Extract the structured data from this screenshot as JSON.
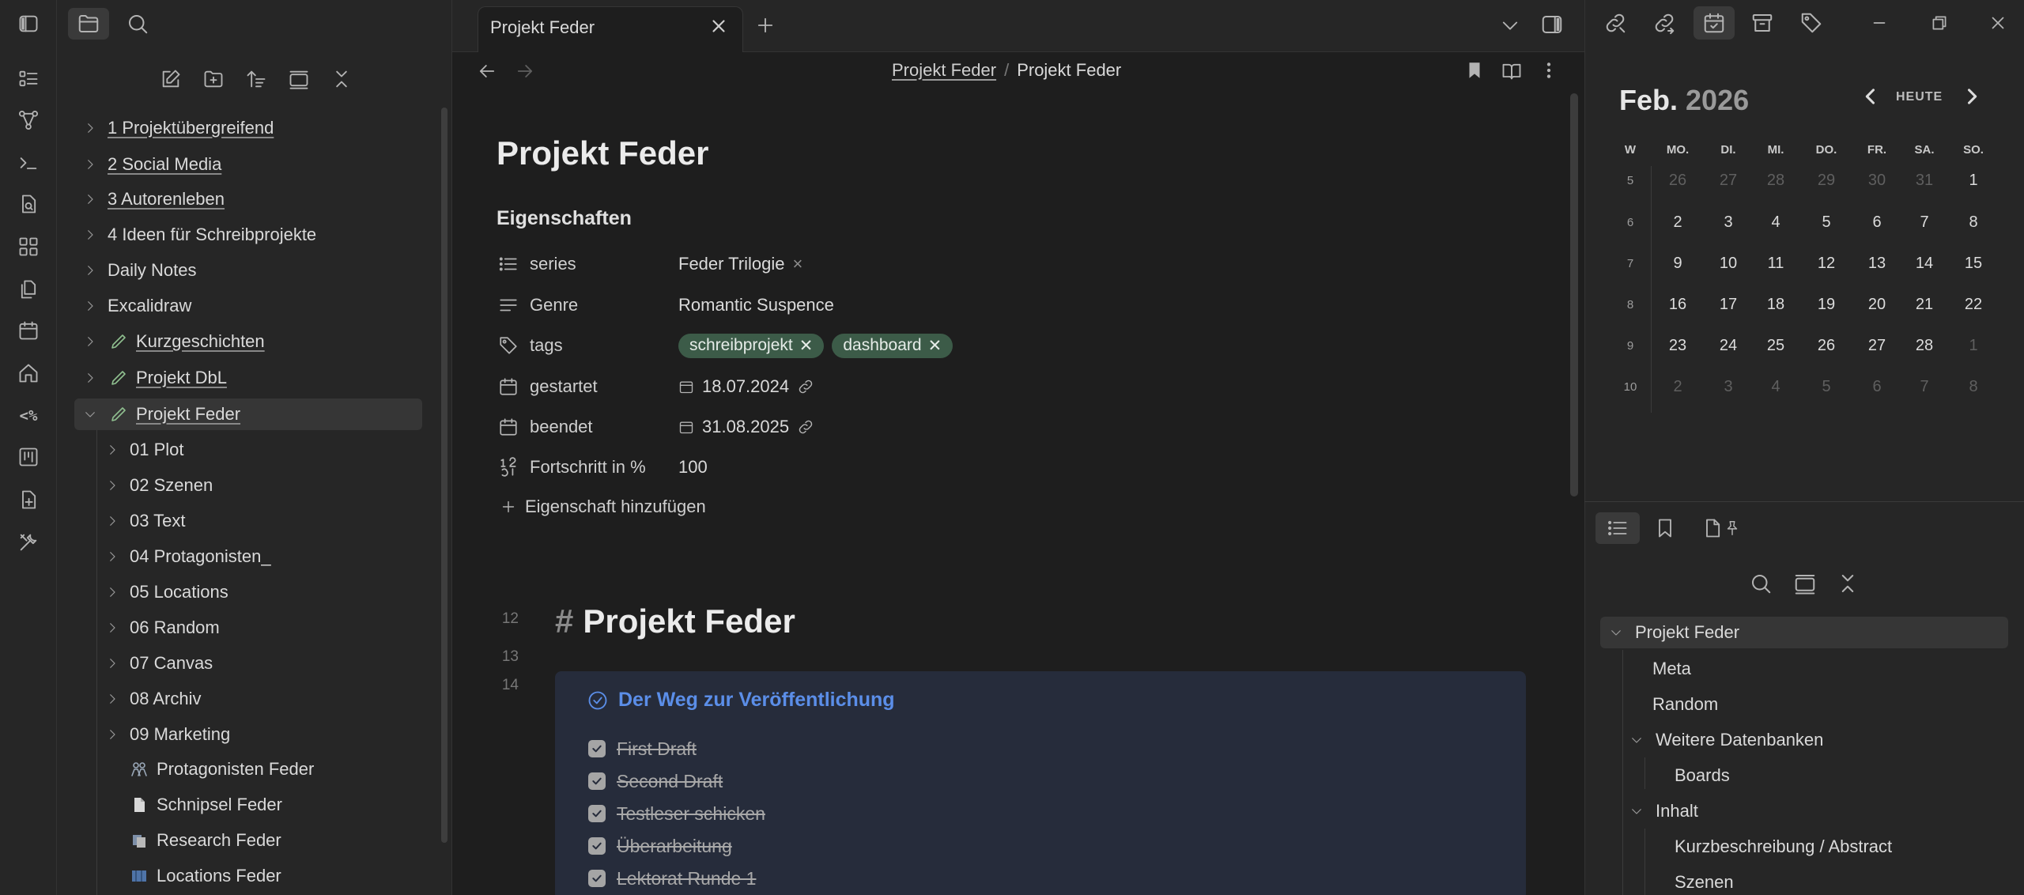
{
  "tab": {
    "title": "Projekt Feder"
  },
  "breadcrumb": {
    "parent": "Projekt Feder",
    "separator": "/",
    "current": "Projekt Feder"
  },
  "file_tree": {
    "items": [
      {
        "label": "1 Projektübergreifend",
        "underlined": true
      },
      {
        "label": "2 Social Media",
        "underlined": true
      },
      {
        "label": "3 Autorenleben",
        "underlined": true
      },
      {
        "label": "4 Ideen für Schreibprojekte",
        "underlined": false
      },
      {
        "label": "Daily Notes",
        "underlined": false
      },
      {
        "label": "Excalidraw",
        "underlined": false
      },
      {
        "label": "Kurzgeschichten",
        "underlined": true
      },
      {
        "label": "Projekt DbL",
        "underlined": true
      },
      {
        "label": "Projekt Feder",
        "underlined": true,
        "selected": true
      }
    ],
    "children": [
      {
        "label": "01 Plot"
      },
      {
        "label": "02 Szenen"
      },
      {
        "label": "03 Text"
      },
      {
        "label": "04 Protagonisten_"
      },
      {
        "label": "05 Locations"
      },
      {
        "label": "06 Random"
      },
      {
        "label": "07 Canvas"
      },
      {
        "label": "08 Archiv"
      },
      {
        "label": "09 Marketing"
      }
    ],
    "files": [
      {
        "label": "Protagonisten Feder",
        "icon": "people-icon"
      },
      {
        "label": "Schnipsel Feder",
        "icon": "page-icon"
      },
      {
        "label": "Research Feder",
        "icon": "books-icon"
      },
      {
        "label": "Locations Feder",
        "icon": "map-icon"
      }
    ]
  },
  "note": {
    "title": "Projekt Feder",
    "properties_title": "Eigenschaften",
    "properties": [
      {
        "key": "series",
        "value": "Feder Trilogie",
        "icon": "list-icon"
      },
      {
        "key": "Genre",
        "value": "Romantic Suspence",
        "icon": "text-icon"
      },
      {
        "key": "tags",
        "tags": [
          "schreibprojekt",
          "dashboard"
        ],
        "icon": "tag-icon"
      },
      {
        "key": "gestartet",
        "value": "18.07.2024",
        "icon": "calendar-icon"
      },
      {
        "key": "beendet",
        "value": "31.08.2025",
        "icon": "calendar-icon"
      },
      {
        "key": "Fortschritt in %",
        "value": "100",
        "icon": "number-icon"
      }
    ],
    "add_property": "Eigenschaft hinzufügen",
    "line_numbers": [
      "12",
      "13",
      "14"
    ],
    "heading_hash": "#",
    "heading": "Projekt Feder",
    "callout_title": "Der Weg zur Veröffentlichung",
    "tasks": [
      {
        "label": "First Draft",
        "done": true
      },
      {
        "label": "Second Draft",
        "done": true
      },
      {
        "label": "Testleser schicken",
        "done": true
      },
      {
        "label": "Überarbeitung",
        "done": true
      },
      {
        "label": "Lektorat Runde 1",
        "done": true
      }
    ]
  },
  "calendar": {
    "month": "Feb.",
    "year": "2026",
    "today_label": "HEUTE",
    "week_header": "W",
    "weekdays": [
      "MO.",
      "DI.",
      "MI.",
      "DO.",
      "FR.",
      "SA.",
      "SO."
    ],
    "weeks": [
      {
        "w": "5",
        "days": [
          "26",
          "27",
          "28",
          "29",
          "30",
          "31",
          "1"
        ],
        "dim": [
          true,
          true,
          true,
          true,
          true,
          true,
          false
        ]
      },
      {
        "w": "6",
        "days": [
          "2",
          "3",
          "4",
          "5",
          "6",
          "7",
          "8"
        ],
        "dim": [
          false,
          false,
          false,
          false,
          false,
          false,
          false
        ]
      },
      {
        "w": "7",
        "days": [
          "9",
          "10",
          "11",
          "12",
          "13",
          "14",
          "15"
        ],
        "dim": [
          false,
          false,
          false,
          false,
          false,
          false,
          false
        ]
      },
      {
        "w": "8",
        "days": [
          "16",
          "17",
          "18",
          "19",
          "20",
          "21",
          "22"
        ],
        "dim": [
          false,
          false,
          false,
          false,
          false,
          false,
          false
        ]
      },
      {
        "w": "9",
        "days": [
          "23",
          "24",
          "25",
          "26",
          "27",
          "28",
          "1"
        ],
        "dim": [
          false,
          false,
          false,
          false,
          false,
          false,
          true
        ]
      },
      {
        "w": "10",
        "days": [
          "2",
          "3",
          "4",
          "5",
          "6",
          "7",
          "8"
        ],
        "dim": [
          true,
          true,
          true,
          true,
          true,
          true,
          true
        ]
      }
    ]
  },
  "outline": {
    "items": [
      {
        "label": "Projekt Feder",
        "level": 0,
        "collapsible": true,
        "selected": true
      },
      {
        "label": "Meta",
        "level": 1,
        "collapsible": false
      },
      {
        "label": "Random",
        "level": 1,
        "collapsible": false
      },
      {
        "label": "Weitere Datenbanken",
        "level": 1,
        "collapsible": true
      },
      {
        "label": "Boards",
        "level": 2,
        "collapsible": false
      },
      {
        "label": "Inhalt",
        "level": 1,
        "collapsible": true
      },
      {
        "label": "Kurzbeschreibung / Abstract",
        "level": 2,
        "collapsible": false
      },
      {
        "label": "Szenen",
        "level": 2,
        "collapsible": false
      }
    ]
  },
  "colors": {
    "accent_blue": "#5b8ee8",
    "tag_green": "#3c5b48",
    "background": "#1e1e1e",
    "sidebar": "#262626"
  }
}
